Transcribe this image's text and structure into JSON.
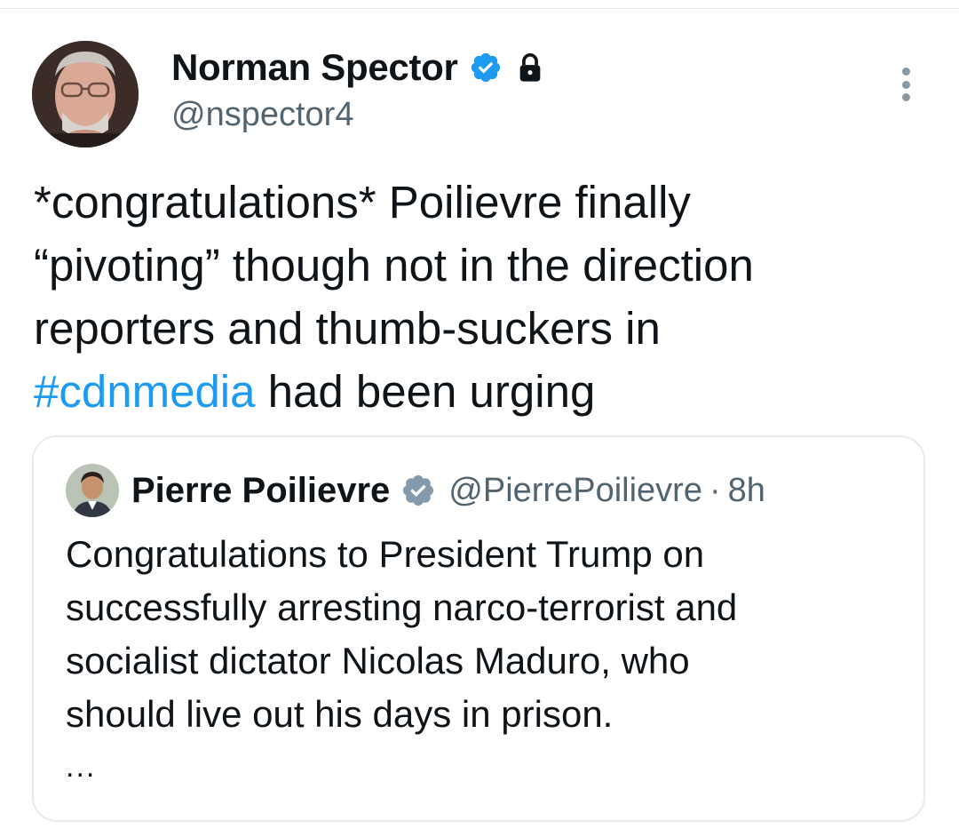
{
  "author": {
    "name": "Norman Spector",
    "handle": "@nspector4",
    "verified": true,
    "protected": true,
    "avatar_icon": "avatar-norman-spector"
  },
  "tweet": {
    "text_lines": [
      "*congratulations* Poilievre finally",
      "“pivoting” though not in the direction",
      "reporters and thumb-suckers in"
    ],
    "hashtag": "#cdnmedia",
    "after_hashtag": " had been urging"
  },
  "quote": {
    "name": "Pierre Poilievre",
    "handle": "@PierrePoilievre",
    "separator": "·",
    "time": "8h",
    "verified_color": "#829aab",
    "text_lines": [
      "Congratulations to President Trump on",
      "successfully arresting narco-terrorist and",
      "socialist dictator Nicolas Maduro, who",
      "should live out his days in prison."
    ],
    "truncated_marker": "..."
  },
  "colors": {
    "link": "#1d9bf0",
    "verified_blue": "#1d9bf0",
    "secondary_text": "#536471",
    "border": "#e6ebee"
  }
}
